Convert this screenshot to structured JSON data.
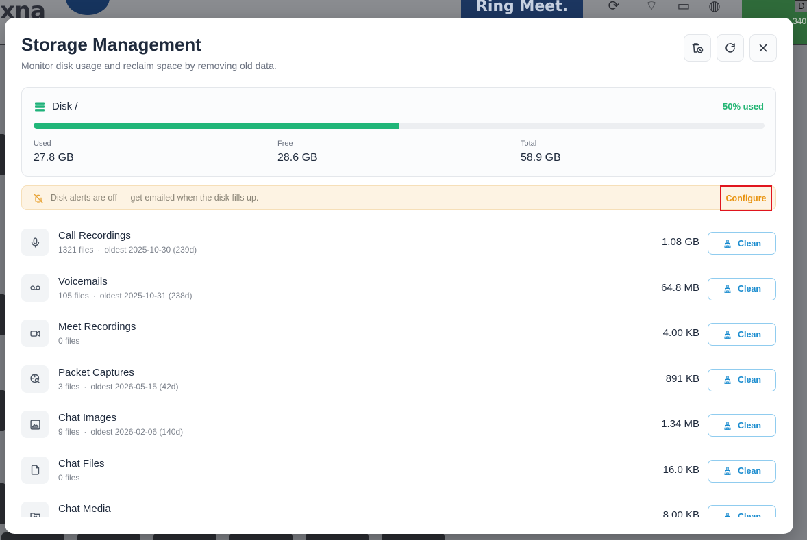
{
  "background": {
    "logo_text": "xna",
    "brand_text": "Ring Meet.",
    "badge_letter": "D",
    "badge_num": "340"
  },
  "modal": {
    "title": "Storage Management",
    "subtitle": "Monitor disk usage and reclaim space by removing old data.",
    "header_buttons": [
      {
        "name": "schedule-cleanup-button",
        "icon": "clock-trash-icon"
      },
      {
        "name": "refresh-button",
        "icon": "refresh-icon"
      },
      {
        "name": "close-button",
        "icon": "close-icon"
      }
    ]
  },
  "disk": {
    "label": "Disk /",
    "used_percent_label": "50% used",
    "used_fraction": 0.5,
    "used_label": "Used",
    "used_value": "27.8 GB",
    "free_label": "Free",
    "free_value": "28.6 GB",
    "total_label": "Total",
    "total_value": "58.9 GB"
  },
  "alert": {
    "text": "Disk alerts are off — get emailed when the disk fills up.",
    "action_label": "Configure"
  },
  "categories": [
    {
      "name": "Call Recordings",
      "files": "1321 files",
      "oldest": "oldest 2025-10-30 (239d)",
      "size": "1.08 GB",
      "icon": "microphone-icon"
    },
    {
      "name": "Voicemails",
      "files": "105 files",
      "oldest": "oldest 2025-10-31 (238d)",
      "size": "64.8 MB",
      "icon": "voicemail-icon"
    },
    {
      "name": "Meet Recordings",
      "files": "0 files",
      "oldest": "",
      "size": "4.00 KB",
      "icon": "video-camera-icon"
    },
    {
      "name": "Packet Captures",
      "files": "3 files",
      "oldest": "oldest 2026-05-15 (42d)",
      "size": "891 KB",
      "icon": "network-search-icon"
    },
    {
      "name": "Chat Images",
      "files": "9 files",
      "oldest": "oldest 2026-02-06 (140d)",
      "size": "1.34 MB",
      "icon": "image-icon"
    },
    {
      "name": "Chat Files",
      "files": "0 files",
      "oldest": "",
      "size": "16.0 KB",
      "icon": "file-icon"
    },
    {
      "name": "Chat Media",
      "files": "",
      "oldest": "",
      "size": "8.00 KB",
      "icon": "media-folder-icon"
    }
  ],
  "clean_label": "Clean",
  "colors": {
    "accent": "#1a8ccf",
    "success": "#20b679",
    "warning": "#e8920e",
    "highlight": "#e0151e"
  }
}
